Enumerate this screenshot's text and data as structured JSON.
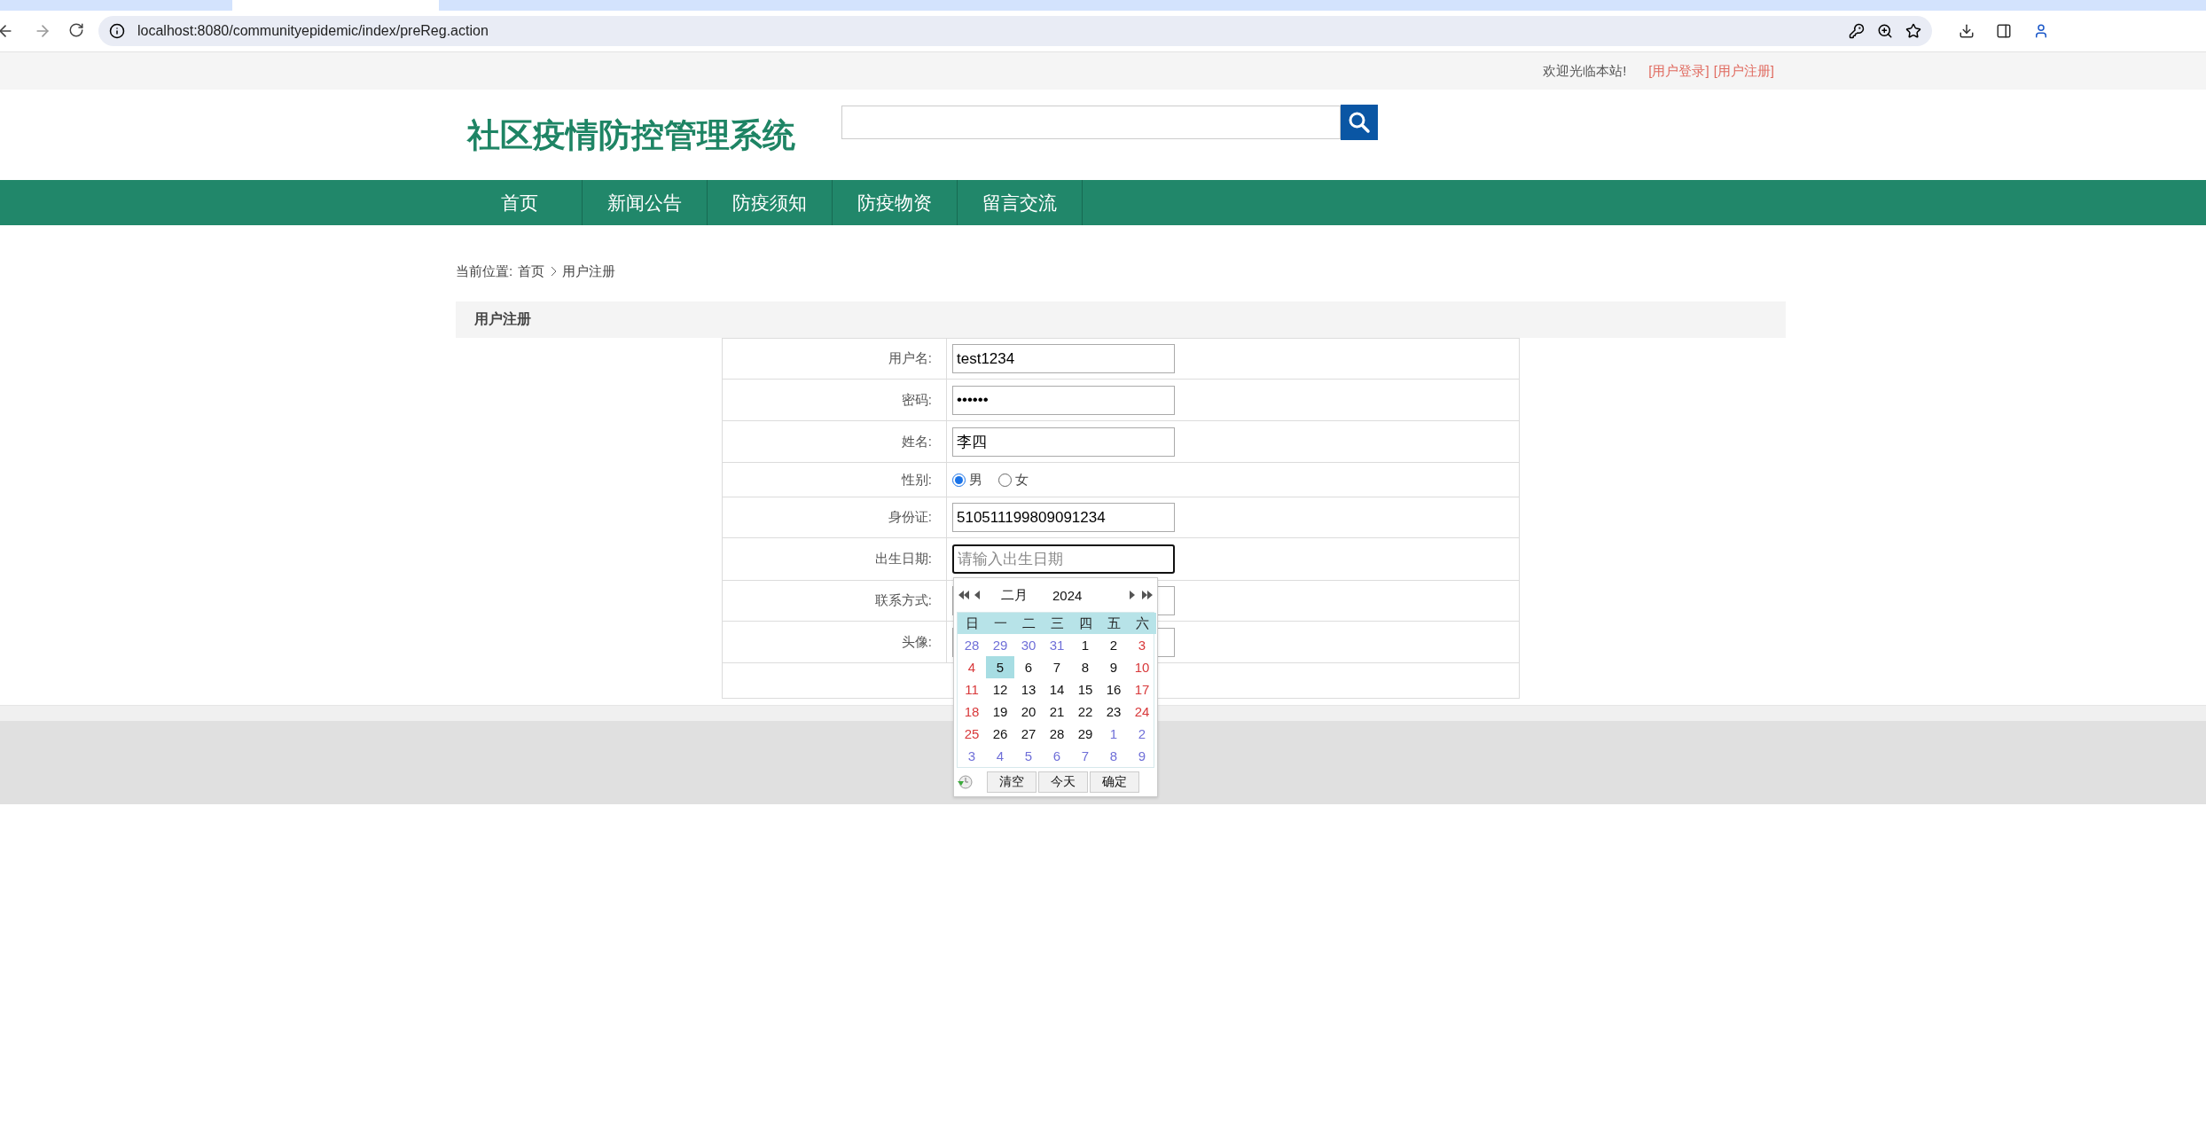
{
  "browser": {
    "url": "localhost:8080/communityepidemic/index/preReg.action"
  },
  "topbar": {
    "welcome": "欢迎光临本站!",
    "links": [
      "[用户登录]",
      "[用户注册]"
    ]
  },
  "header": {
    "title": "社区疫情防控管理系统"
  },
  "nav": {
    "items": [
      "首页",
      "新闻公告",
      "防疫须知",
      "防疫物资",
      "留言交流"
    ]
  },
  "breadcrumb": {
    "label": "当前位置:",
    "items": [
      "首页",
      "用户注册"
    ]
  },
  "section_title": "用户注册",
  "form": {
    "fields": [
      {
        "kind": "text",
        "label": "用户名:",
        "value": "test1234"
      },
      {
        "kind": "text",
        "label": "密码:",
        "value": "••••••"
      },
      {
        "kind": "text",
        "label": "姓名:",
        "value": "李四"
      },
      {
        "kind": "radio",
        "label": "性别:",
        "options": [
          {
            "label": "男",
            "selected": true
          },
          {
            "label": "女",
            "selected": false
          }
        ]
      },
      {
        "kind": "text",
        "label": "身份证:",
        "value": "510511199809091234"
      },
      {
        "kind": "date",
        "label": "出生日期:",
        "placeholder": "请输入出生日期",
        "focused": true
      },
      {
        "kind": "text",
        "label": "联系方式:"
      },
      {
        "kind": "text",
        "label": "头像:"
      }
    ]
  },
  "calendar": {
    "month": "二月",
    "year": "2024",
    "weekdays": [
      "日",
      "一",
      "二",
      "三",
      "四",
      "五",
      "六"
    ],
    "weeks": [
      [
        {
          "day": "28",
          "kind": "other",
          "selected": false
        },
        {
          "day": "29",
          "kind": "other",
          "selected": false
        },
        {
          "day": "30",
          "kind": "other",
          "selected": false
        },
        {
          "day": "31",
          "kind": "other",
          "selected": false
        },
        {
          "day": "1",
          "kind": "normal",
          "selected": false
        },
        {
          "day": "2",
          "kind": "normal",
          "selected": false
        },
        {
          "day": "3",
          "kind": "weekend",
          "selected": false
        }
      ],
      [
        {
          "day": "4",
          "kind": "weekend",
          "selected": false
        },
        {
          "day": "5",
          "kind": "normal",
          "selected": true
        },
        {
          "day": "6",
          "kind": "normal",
          "selected": false
        },
        {
          "day": "7",
          "kind": "normal",
          "selected": false
        },
        {
          "day": "8",
          "kind": "normal",
          "selected": false
        },
        {
          "day": "9",
          "kind": "normal",
          "selected": false
        },
        {
          "day": "10",
          "kind": "weekend",
          "selected": false
        }
      ],
      [
        {
          "day": "11",
          "kind": "weekend",
          "selected": false
        },
        {
          "day": "12",
          "kind": "normal",
          "selected": false
        },
        {
          "day": "13",
          "kind": "normal",
          "selected": false
        },
        {
          "day": "14",
          "kind": "normal",
          "selected": false
        },
        {
          "day": "15",
          "kind": "normal",
          "selected": false
        },
        {
          "day": "16",
          "kind": "normal",
          "selected": false
        },
        {
          "day": "17",
          "kind": "weekend",
          "selected": false
        }
      ],
      [
        {
          "day": "18",
          "kind": "weekend",
          "selected": false
        },
        {
          "day": "19",
          "kind": "normal",
          "selected": false
        },
        {
          "day": "20",
          "kind": "normal",
          "selected": false
        },
        {
          "day": "21",
          "kind": "normal",
          "selected": false
        },
        {
          "day": "22",
          "kind": "normal",
          "selected": false
        },
        {
          "day": "23",
          "kind": "normal",
          "selected": false
        },
        {
          "day": "24",
          "kind": "weekend",
          "selected": false
        }
      ],
      [
        {
          "day": "25",
          "kind": "weekend",
          "selected": false
        },
        {
          "day": "26",
          "kind": "normal",
          "selected": false
        },
        {
          "day": "27",
          "kind": "normal",
          "selected": false
        },
        {
          "day": "28",
          "kind": "normal",
          "selected": false
        },
        {
          "day": "29",
          "kind": "normal",
          "selected": false
        },
        {
          "day": "1",
          "kind": "other",
          "selected": false
        },
        {
          "day": "2",
          "kind": "other",
          "selected": false
        }
      ],
      [
        {
          "day": "3",
          "kind": "other",
          "selected": false
        },
        {
          "day": "4",
          "kind": "other",
          "selected": false
        },
        {
          "day": "5",
          "kind": "other",
          "selected": false
        },
        {
          "day": "6",
          "kind": "other",
          "selected": false
        },
        {
          "day": "7",
          "kind": "other",
          "selected": false
        },
        {
          "day": "8",
          "kind": "other",
          "selected": false
        },
        {
          "day": "9",
          "kind": "other",
          "selected": false
        }
      ]
    ],
    "buttons": [
      "清空",
      "今天",
      "确定"
    ]
  }
}
